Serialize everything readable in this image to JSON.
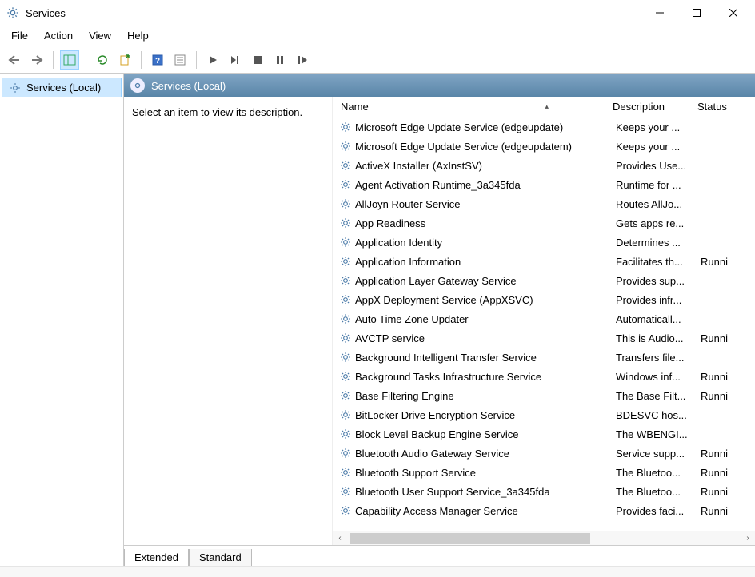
{
  "window": {
    "title": "Services"
  },
  "menu": {
    "file": "File",
    "action": "Action",
    "view": "View",
    "help": "Help"
  },
  "tree": {
    "root": "Services (Local)"
  },
  "panel": {
    "title": "Services (Local)",
    "hint": "Select an item to view its description."
  },
  "columns": {
    "name": "Name",
    "desc": "Description",
    "status": "Status"
  },
  "tabs": {
    "extended": "Extended",
    "standard": "Standard"
  },
  "services": [
    {
      "name": "Microsoft Edge Update Service (edgeupdate)",
      "desc": "Keeps your ...",
      "status": ""
    },
    {
      "name": "Microsoft Edge Update Service (edgeupdatem)",
      "desc": "Keeps your ...",
      "status": ""
    },
    {
      "name": "ActiveX Installer (AxInstSV)",
      "desc": "Provides Use...",
      "status": ""
    },
    {
      "name": "Agent Activation Runtime_3a345fda",
      "desc": "Runtime for ...",
      "status": ""
    },
    {
      "name": "AllJoyn Router Service",
      "desc": "Routes AllJo...",
      "status": ""
    },
    {
      "name": "App Readiness",
      "desc": "Gets apps re...",
      "status": ""
    },
    {
      "name": "Application Identity",
      "desc": "Determines ...",
      "status": ""
    },
    {
      "name": "Application Information",
      "desc": "Facilitates th...",
      "status": "Runni"
    },
    {
      "name": "Application Layer Gateway Service",
      "desc": "Provides sup...",
      "status": ""
    },
    {
      "name": "AppX Deployment Service (AppXSVC)",
      "desc": "Provides infr...",
      "status": ""
    },
    {
      "name": "Auto Time Zone Updater",
      "desc": "Automaticall...",
      "status": ""
    },
    {
      "name": "AVCTP service",
      "desc": "This is Audio...",
      "status": "Runni"
    },
    {
      "name": "Background Intelligent Transfer Service",
      "desc": "Transfers file...",
      "status": ""
    },
    {
      "name": "Background Tasks Infrastructure Service",
      "desc": "Windows inf...",
      "status": "Runni"
    },
    {
      "name": "Base Filtering Engine",
      "desc": "The Base Filt...",
      "status": "Runni"
    },
    {
      "name": "BitLocker Drive Encryption Service",
      "desc": "BDESVC hos...",
      "status": ""
    },
    {
      "name": "Block Level Backup Engine Service",
      "desc": "The WBENGI...",
      "status": ""
    },
    {
      "name": "Bluetooth Audio Gateway Service",
      "desc": "Service supp...",
      "status": "Runni"
    },
    {
      "name": "Bluetooth Support Service",
      "desc": "The Bluetoo...",
      "status": "Runni"
    },
    {
      "name": "Bluetooth User Support Service_3a345fda",
      "desc": "The Bluetoo...",
      "status": "Runni"
    },
    {
      "name": "Capability Access Manager Service",
      "desc": "Provides faci...",
      "status": "Runni"
    }
  ]
}
